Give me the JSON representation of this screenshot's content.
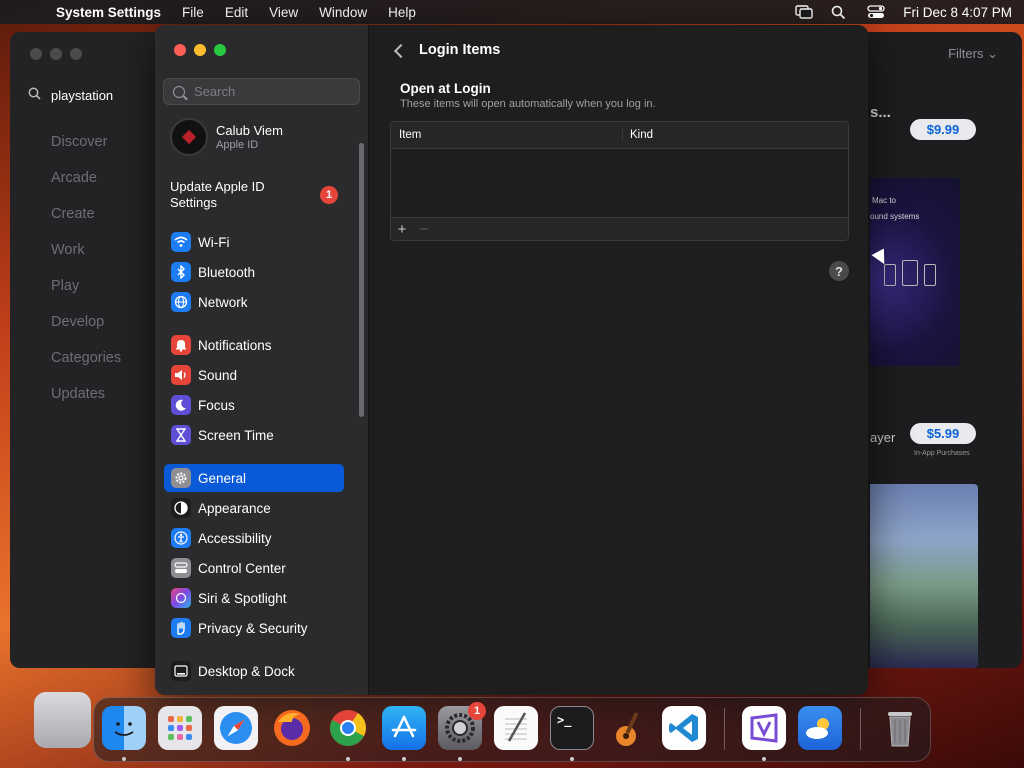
{
  "menubar": {
    "app_name": "System Settings",
    "items": [
      "File",
      "Edit",
      "View",
      "Window",
      "Help"
    ],
    "clock": "Fri Dec 8  4:07 PM"
  },
  "appstore": {
    "search_value": "playstation",
    "nav": [
      "Discover",
      "Arcade",
      "Create",
      "Work",
      "Play",
      "Develop",
      "Categories",
      "Updates"
    ],
    "filters_label": "Filters",
    "truncated_title": "s...",
    "price_1": "$9.99",
    "price_2": "$5.99",
    "layer_text": "ayer",
    "in_app_text": "In-App Purchases",
    "promo_text_1": "Mac to",
    "promo_text_2": "ound systems"
  },
  "settings": {
    "search_placeholder": "Search",
    "profile": {
      "name": "Calub Viem",
      "subtitle": "Apple ID"
    },
    "update_label": "Update Apple ID Settings",
    "update_badge": "1",
    "sidebar_items": [
      {
        "label": "Wi-Fi",
        "icon": "wifi-icon",
        "color": "#1e7cf2"
      },
      {
        "label": "Bluetooth",
        "icon": "bluetooth-icon",
        "color": "#1e7cf2"
      },
      {
        "label": "Network",
        "icon": "globe-icon",
        "color": "#1e7cf2"
      },
      {
        "label": "Notifications",
        "icon": "bell-icon",
        "color": "#e8453a"
      },
      {
        "label": "Sound",
        "icon": "speaker-icon",
        "color": "#e8453a"
      },
      {
        "label": "Focus",
        "icon": "moon-icon",
        "color": "#5e4fd6"
      },
      {
        "label": "Screen Time",
        "icon": "hourglass-icon",
        "color": "#5e4fd6"
      },
      {
        "label": "General",
        "icon": "gear-icon",
        "color": "#8e8e93"
      },
      {
        "label": "Appearance",
        "icon": "appearance-icon",
        "color": "#1c1c1e"
      },
      {
        "label": "Accessibility",
        "icon": "accessibility-icon",
        "color": "#1e7cf2"
      },
      {
        "label": "Control Center",
        "icon": "control-center-icon",
        "color": "#8e8e93"
      },
      {
        "label": "Siri & Spotlight",
        "icon": "siri-icon",
        "color": "#b044c8"
      },
      {
        "label": "Privacy & Security",
        "icon": "hand-icon",
        "color": "#1e7cf2"
      },
      {
        "label": "Desktop & Dock",
        "icon": "dock-icon",
        "color": "#1c1c1e"
      }
    ],
    "active_item": "General",
    "page_title": "Login Items",
    "section_title": "Open at Login",
    "section_subtitle": "These items will open automatically when you log in.",
    "table": {
      "col_item": "Item",
      "col_kind": "Kind"
    },
    "add_label": "+",
    "remove_label": "−",
    "help_label": "?"
  },
  "dock": {
    "apps": [
      "Finder",
      "Launchpad",
      "Safari",
      "Firefox",
      "Chrome",
      "App Store",
      "System Settings",
      "TextEdit",
      "Terminal",
      "GarageBand",
      "VS Code",
      "Visual Studio",
      "Weather",
      "Trash"
    ],
    "settings_badge": "1"
  }
}
